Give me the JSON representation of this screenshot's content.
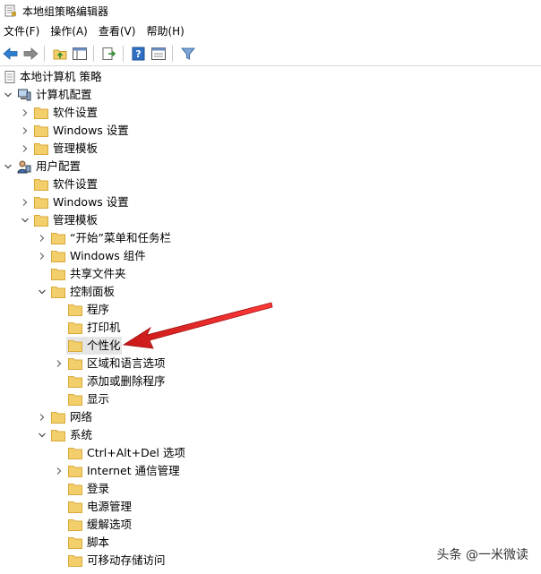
{
  "window": {
    "title": "本地组策略编辑器"
  },
  "menu": [
    "文件(F)",
    "操作(A)",
    "查看(V)",
    "帮助(H)"
  ],
  "toolbar": {
    "icons": [
      "back-arrow-icon",
      "forward-arrow-icon",
      "up-folder-icon",
      "show-hide-tree-icon",
      "export-list-icon",
      "help-icon",
      "properties-icon",
      "filter-icon"
    ]
  },
  "tree": {
    "root": "本地计算机 策略",
    "computer_config": "计算机配置",
    "cc_software": "软件设置",
    "cc_windows": "Windows 设置",
    "cc_admin": "管理模板",
    "user_config": "用户配置",
    "uc_software": "软件设置",
    "uc_windows": "Windows 设置",
    "uc_admin": "管理模板",
    "start_taskbar": "“开始”菜单和任务栏",
    "win_components": "Windows 组件",
    "shared_folders": "共享文件夹",
    "control_panel": "控制面板",
    "programs": "程序",
    "printers": "打印机",
    "personalization": "个性化",
    "region_lang": "区域和语言选项",
    "add_remove": "添加或删除程序",
    "display": "显示",
    "network": "网络",
    "system": "系统",
    "ctrl_alt_del": "Ctrl+Alt+Del 选项",
    "internet_comm": "Internet 通信管理",
    "logon": "登录",
    "power": "电源管理",
    "mitigation": "缓解选项",
    "scripts": "脚本",
    "removable": "可移动存储访问"
  },
  "watermark": "头条 @一米微读",
  "colors": {
    "folder": "#f3cf6b",
    "folder_edge": "#d9a93a",
    "arrow": "#e02020",
    "selected": "#e5e5e5"
  }
}
